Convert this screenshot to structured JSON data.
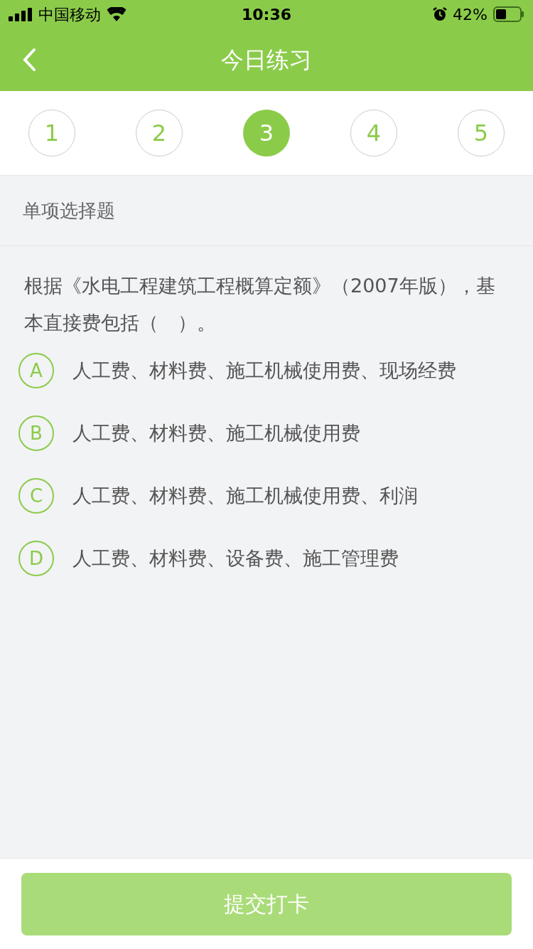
{
  "status_bar": {
    "carrier": "中国移动",
    "time": "10:36",
    "battery": "42%"
  },
  "nav": {
    "title": "今日练习"
  },
  "steps": [
    {
      "label": "1",
      "selected": false
    },
    {
      "label": "2",
      "selected": false
    },
    {
      "label": "3",
      "selected": true
    },
    {
      "label": "4",
      "selected": false
    },
    {
      "label": "5",
      "selected": false
    }
  ],
  "section": "单项选择题",
  "question": "根据《水电工程建筑工程概算定额》（2007年版），基本直接费包括（　）。",
  "options": [
    {
      "letter": "A",
      "text": "人工费、材料费、施工机械使用费、现场经费",
      "selected": false
    },
    {
      "letter": "B",
      "text": "人工费、材料费、施工机械使用费",
      "selected": false
    },
    {
      "letter": "C",
      "text": "人工费、材料费、施工机械使用费、利润",
      "selected": false
    },
    {
      "letter": "D",
      "text": "人工费、材料费、设备费、施工管理费",
      "selected": false
    }
  ],
  "submit": {
    "label": "提交打卡",
    "disabled": true
  }
}
